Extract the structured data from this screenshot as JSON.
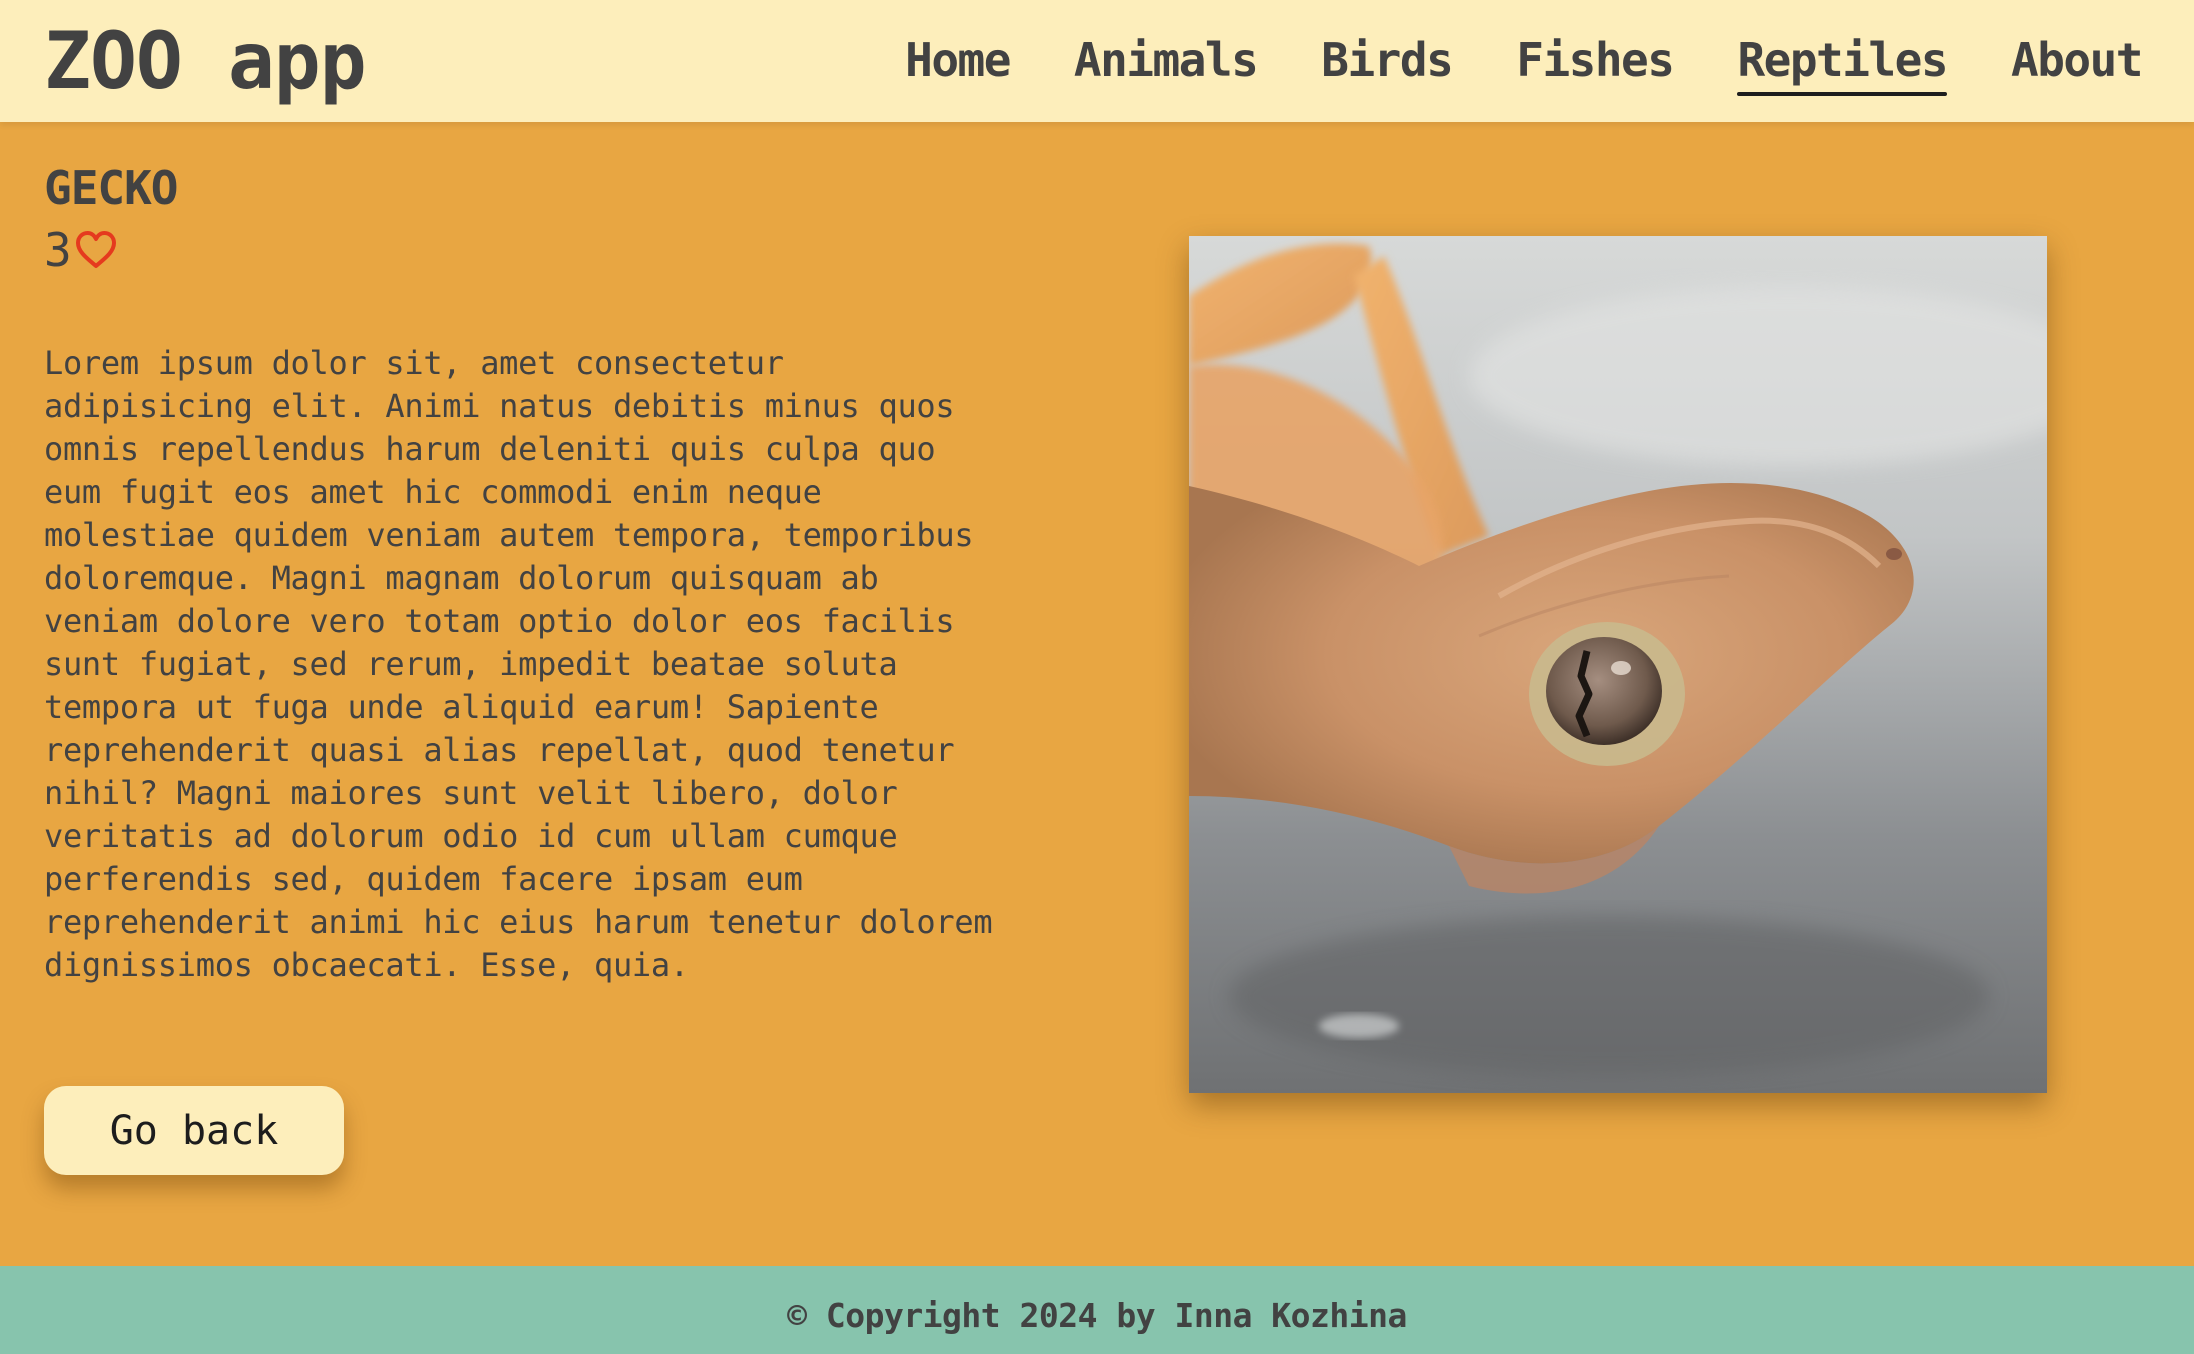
{
  "app": {
    "title": "ZOO app"
  },
  "nav": {
    "items": [
      {
        "label": "Home"
      },
      {
        "label": "Animals"
      },
      {
        "label": "Birds"
      },
      {
        "label": "Fishes"
      },
      {
        "label": "Reptiles"
      },
      {
        "label": "About"
      }
    ],
    "active": "Reptiles"
  },
  "animal": {
    "name": "GECKO",
    "likes": "3",
    "like_icon": "heart-outline-icon",
    "description": "Lorem ipsum dolor sit, amet consectetur adipisicing elit. Animi natus debitis minus quos omnis repellendus harum deleniti quis culpa quo eum fugit eos amet hic commodi enim neque molestiae quidem veniam autem tempora, temporibus doloremque. Magni magnam dolorum quisquam ab veniam dolore vero totam optio dolor eos facilis sunt fugiat, sed rerum, impedit beatae soluta tempora ut fuga unde aliquid earum! Sapiente reprehenderit quasi alias repellat, quod tenetur nihil? Magni maiores sunt velit libero, dolor veritatis ad dolorum odio id cum ullam cumque perferendis sed, quidem facere ipsam eum reprehenderit animi hic eius harum tenetur dolorem dignissimos obcaecati. Esse, quia."
  },
  "actions": {
    "back_label": "Go back"
  },
  "footer": {
    "copyright": "© Copyright 2024 by Inna Kozhina"
  },
  "colors": {
    "header_bg": "#fdeebb",
    "page_bg": "#e8a642",
    "footer_bg": "#87c4ad",
    "heart": "#e53a1e",
    "text": "#424242"
  }
}
